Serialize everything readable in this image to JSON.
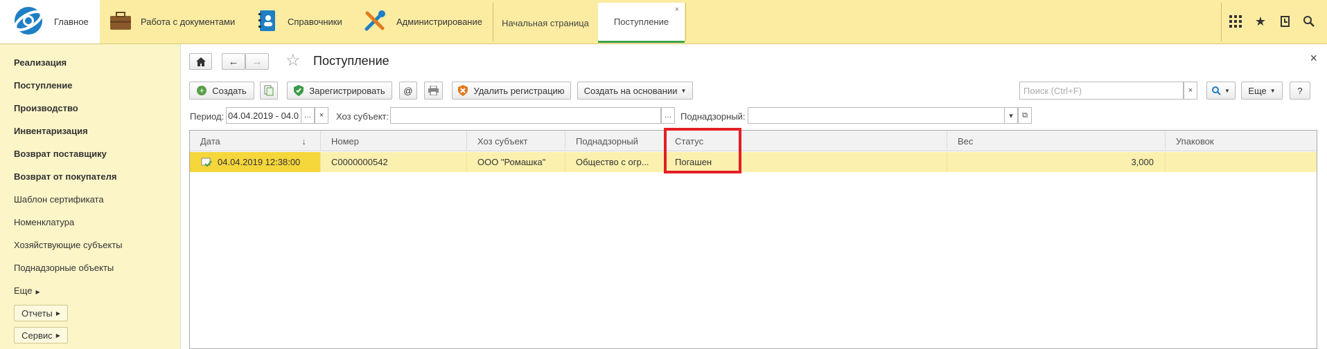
{
  "topbar": {
    "main_label": "Главное",
    "sections": [
      {
        "label": "Работа с документами",
        "icon": "briefcase-icon"
      },
      {
        "label": "Справочники",
        "icon": "address-book-icon"
      },
      {
        "label": "Администрирование",
        "icon": "tools-icon"
      }
    ],
    "open_tabs": [
      {
        "label": "Начальная страница"
      },
      {
        "label": "Поступление",
        "active": true
      }
    ],
    "close_glyph": "×"
  },
  "sidebar": {
    "items": [
      {
        "label": "Реализация",
        "bold": true
      },
      {
        "label": "Поступление",
        "bold": true
      },
      {
        "label": "Производство",
        "bold": true
      },
      {
        "label": "Инвентаризация",
        "bold": true
      },
      {
        "label": "Возврат поставщику",
        "bold": true
      },
      {
        "label": "Возврат от покупателя",
        "bold": true
      },
      {
        "label": "Шаблон сертификата",
        "bold": false
      },
      {
        "label": "Номенклатура",
        "bold": false
      },
      {
        "label": "Хозяйствующие субъекты",
        "bold": false
      },
      {
        "label": "Поднадзорные объекты",
        "bold": false
      },
      {
        "label": "Еще",
        "bold": false
      }
    ],
    "reports_label": "Отчеты",
    "service_label": "Сервис"
  },
  "main": {
    "title": "Поступление",
    "close_glyph": "×",
    "toolbar": {
      "create_label": "Создать",
      "register_label": "Зарегистрировать",
      "at_label": "@",
      "delete_reg_label": "Удалить регистрацию",
      "create_based_label": "Создать на основании",
      "search_placeholder": "Поиск (Ctrl+F)",
      "more_label": "Еще",
      "help_label": "?"
    },
    "filters": {
      "period_label": "Период:",
      "period_value": "04.04.2019 - 04.0",
      "subject_label": "Хоз субъект:",
      "subject_value": "",
      "supervised_label": "Поднадзорный:",
      "supervised_value": ""
    },
    "table": {
      "columns": [
        "Дата",
        "Номер",
        "Хоз субъект",
        "Поднадзорный",
        "Статус",
        "Вес",
        "Упаковок"
      ],
      "sort_glyph": "↓",
      "rows": [
        {
          "date": "04.04.2019 12:38:00",
          "number": "С0000000542",
          "subject": "ООО \"Ромашка\"",
          "supervised": "Общество с огр...",
          "status": "Погашен",
          "weight": "3,000",
          "packs": ""
        }
      ]
    }
  },
  "colors": {
    "accent_yellow": "#fbeca2",
    "selected_row": "#fbf0ae",
    "selected_cell": "#f5d63b",
    "highlight_red": "#e31e24",
    "active_tab_green": "#38a44a"
  }
}
